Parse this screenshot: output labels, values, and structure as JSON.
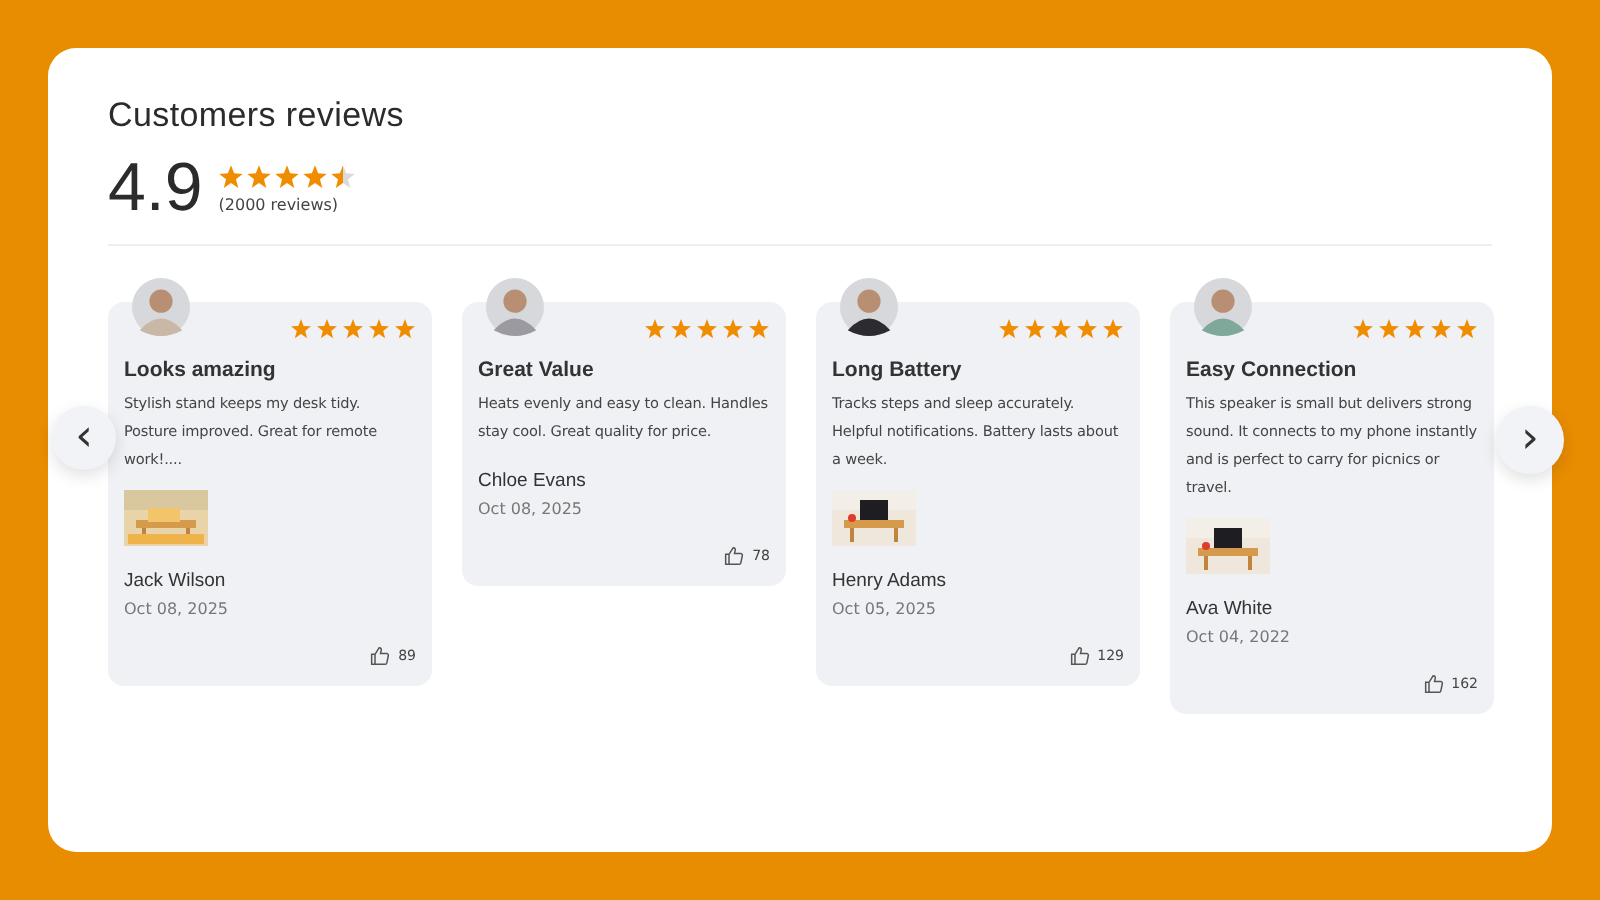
{
  "title": "Customers reviews",
  "summary": {
    "score": "4.9",
    "stars": 4.5,
    "count": "(2000 reviews)"
  },
  "nav": {
    "prev": "‹",
    "next": "›"
  },
  "reviews": [
    {
      "stars": 5,
      "title": "Looks amazing",
      "text": "Stylish stand keeps my desk tidy. Posture improved. Great for remote work!....",
      "has_photo": true,
      "name": "Jack Wilson",
      "date": "Oct 08, 2025",
      "likes": "89"
    },
    {
      "stars": 5,
      "title": "Great Value",
      "text": "Heats evenly and easy to clean. Handles stay cool. Great quality for price.",
      "has_photo": false,
      "name": "Chloe Evans",
      "date": "Oct 08, 2025",
      "likes": "78"
    },
    {
      "stars": 5,
      "title": "Long Battery",
      "text": "Tracks steps and sleep accurately. Helpful notifications. Battery lasts about a week.",
      "has_photo": true,
      "name": "Henry Adams",
      "date": "Oct 05, 2025",
      "likes": "129"
    },
    {
      "stars": 5,
      "title": "Easy Connection",
      "text": "This speaker is small but delivers strong sound. It connects to my phone instantly and is perfect to carry for picnics or travel.",
      "has_photo": true,
      "name": "Ava White",
      "date": "Oct 04, 2022",
      "likes": "162"
    }
  ]
}
